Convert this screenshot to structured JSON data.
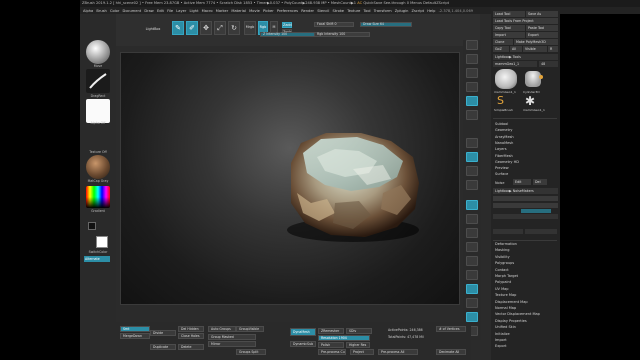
{
  "title_bar": {
    "app": "ZBrush 2019.1.2",
    "doc": "[ hhi_scene02 ]",
    "stats": "• Free Mem 23.87GB  • Active Mem 7774  • Scratch Disk 1853  • Timer▶0.037  • PolyCount▶248.938 MP  • MeshCount▶1",
    "ac": "AC",
    "quicksave": "QuickSave",
    "see_through": "See-through  0",
    "menus": "Menus",
    "default_script": "DefaultZScript"
  },
  "menu_bar": [
    "Alpha",
    "Brush",
    "Color",
    "Document",
    "Draw",
    "Edit",
    "File",
    "Layer",
    "Light",
    "Macro",
    "Marker",
    "Material",
    "Movie",
    "Picker",
    "Preferences",
    "Render",
    "Stencil",
    "Stroke",
    "Texture",
    "Tool",
    "Transform",
    "Zplugin",
    "Zscript",
    "Help"
  ],
  "menu_readout": "-2.378,1.404,0.069",
  "left_shelf": {
    "brush_label": "Move",
    "stroke_label": "DragRect",
    "alpha_label": "Alpha Off",
    "texture_label": "Texture Off",
    "material_label": "MatCap Gray",
    "gradient_label": "Gradient",
    "switch_label": "SwitchColor",
    "alternate_label": "Alternate"
  },
  "toolbar": {
    "lightbox": "LightBox",
    "edit": "Edit",
    "draw": "Draw",
    "move": "Move",
    "scale": "Scale",
    "rotate": "Rotate",
    "mrgb": "Mrgb",
    "rgb": "Rgb",
    "m": "M",
    "zadd": "Zadd",
    "zsub": "Zsub",
    "zcut": "Zcut",
    "focal_shift": "Focal Shift 0",
    "draw_size": "Draw Size 64",
    "z_intensity": "Z Intensity 100",
    "rgb_intensity": "Rgb Intensity 100"
  },
  "right_panel": {
    "top_buttons": [
      "Load Tool",
      "Save As",
      "Load Tools From Project",
      "Copy Tool",
      "Paste Tool",
      "Import",
      "Export",
      "Clone",
      "Make PolyMesh3D",
      "GoZ",
      "All",
      "Visible",
      "R"
    ],
    "lightbox_tools": "Lightbox▶ Tools",
    "tool_name": "mammGeo1_1",
    "tool_value": "48",
    "thumb_labels": [
      "mammGeo1_1",
      "Cylinder3D",
      "SimpleBrush",
      "mammGeo1_1"
    ],
    "subtool_list": [
      "Subtool",
      "Geometry",
      "ArrayMesh",
      "NanoMesh",
      "Layers",
      "FiberMesh",
      "Geometry HD",
      "Preview",
      "Surface"
    ],
    "noise_label": "Noise",
    "noise_buttons": [
      "Edit",
      "Del"
    ],
    "lightbox_noise": "Lightbox▶ NoiseMakers",
    "deformation_list": [
      "Deformation",
      "Masking",
      "Visibility",
      "Polygroups",
      "Contact",
      "Morph Target",
      "Polypaint",
      "UV Map",
      "Texture Map",
      "Displacement Map",
      "Normal Map",
      "Vector Displacement Map",
      "Display Properties",
      "Unified Skin",
      "Initialize",
      "Import",
      "Export"
    ]
  },
  "bottom_shelf": {
    "dynamesh": "DynaMesh",
    "zremesher": "ZRemesher",
    "smt": "Smt",
    "sdiv": "SDiv",
    "del_hidden": "Del Hidden",
    "close_holes": "Close Holes",
    "merge_down": "MergeDown",
    "divide": "Divide",
    "auto_groups": "Auto Groups",
    "group_visible": "GroupVisible",
    "group_masked": "Group Masked",
    "duplicate": "Duplicate",
    "delete": "Delete",
    "mirror": "Mirror",
    "groups_split": "Groups Split",
    "dynamic_label": "DynamicSub",
    "resolution": "Resolution 1904",
    "polish": "Polish",
    "project": "Project",
    "higher_res": "Higher Res",
    "active_points": "ActivePoints: 246,386",
    "total_points": "TotalPoints: 47,478 Mil",
    "del_lower": "Del Lower",
    "del_higher": "Del Higher",
    "pre_process": "Pre-process Current",
    "decimate": "Decimate All",
    "pre_process_all": "Pre-process All",
    "no_vertices": "# of Vertices"
  },
  "colors": {
    "accent": "#2c8ea6",
    "orange": "#e3a43b"
  }
}
